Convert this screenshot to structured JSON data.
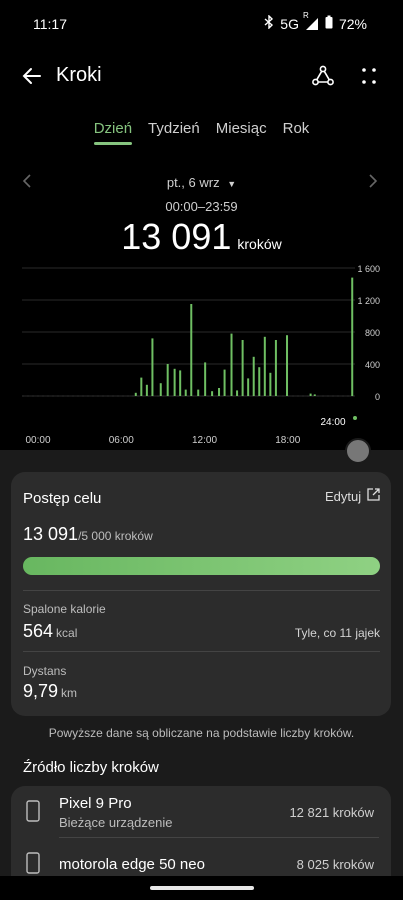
{
  "status": {
    "time": "11:17",
    "bluetooth_icon": "bluetooth-icon",
    "network": "5G",
    "roaming": "R",
    "battery": "72%"
  },
  "appbar": {
    "title": "Kroki",
    "back_icon": "arrow-left-icon",
    "share_icon": "share-icon",
    "more_icon": "more-grid-icon"
  },
  "tabs": [
    {
      "label": "Dzień",
      "active": true
    },
    {
      "label": "Tydzień",
      "active": false
    },
    {
      "label": "Miesiąc",
      "active": false
    },
    {
      "label": "Rok",
      "active": false
    }
  ],
  "date": {
    "selected": "pt., 6 wrz",
    "range": "00:00–23:59",
    "total": "13 091",
    "unit": "kroków"
  },
  "chart_data": {
    "type": "bar",
    "title": "",
    "xlabel": "",
    "ylabel": "",
    "x_tick_labels": [
      "00:00",
      "06:00",
      "12:00",
      "18:00",
      "24:00"
    ],
    "y_tick_labels": [
      "0",
      "400",
      "800",
      "1 200",
      "1 600"
    ],
    "ylim": [
      0,
      1600
    ],
    "x_range_hours": [
      0,
      24
    ],
    "bar_color": "#6fbf63",
    "values": [
      {
        "x": 8.2,
        "y": 40
      },
      {
        "x": 8.6,
        "y": 230
      },
      {
        "x": 9.0,
        "y": 140
      },
      {
        "x": 9.4,
        "y": 720
      },
      {
        "x": 10.0,
        "y": 160
      },
      {
        "x": 10.5,
        "y": 400
      },
      {
        "x": 11.0,
        "y": 340
      },
      {
        "x": 11.4,
        "y": 320
      },
      {
        "x": 11.8,
        "y": 80
      },
      {
        "x": 12.2,
        "y": 1150
      },
      {
        "x": 12.7,
        "y": 80
      },
      {
        "x": 13.2,
        "y": 420
      },
      {
        "x": 13.7,
        "y": 60
      },
      {
        "x": 14.2,
        "y": 100
      },
      {
        "x": 14.6,
        "y": 330
      },
      {
        "x": 15.1,
        "y": 780
      },
      {
        "x": 15.5,
        "y": 70
      },
      {
        "x": 15.9,
        "y": 700
      },
      {
        "x": 16.3,
        "y": 220
      },
      {
        "x": 16.7,
        "y": 490
      },
      {
        "x": 17.1,
        "y": 360
      },
      {
        "x": 17.5,
        "y": 740
      },
      {
        "x": 17.9,
        "y": 290
      },
      {
        "x": 18.3,
        "y": 700
      },
      {
        "x": 19.1,
        "y": 760
      },
      {
        "x": 20.8,
        "y": 30
      },
      {
        "x": 21.1,
        "y": 20
      },
      {
        "x": 23.8,
        "y": 1480
      }
    ]
  },
  "goal_card": {
    "title": "Postęp celu",
    "edit_label": "Edytuj",
    "edit_icon": "external-edit-icon",
    "value": "13 091",
    "goal": "/5 000 kroków",
    "progress": 1.0,
    "calories_label": "Spalone kalorie",
    "calories_value": "564",
    "calories_unit": "kcal",
    "calories_note": "Tyle, co 11 jajek",
    "distance_label": "Dystans",
    "distance_value": "9,79",
    "distance_unit": "km"
  },
  "note": "Powyższe dane są obliczane na podstawie liczby kroków.",
  "sources": {
    "title": "Źródło liczby kroków",
    "devices": [
      {
        "name": "Pixel 9 Pro",
        "sub": "Bieżące urządzenie",
        "steps": "12 821 kroków",
        "icon": "phone-icon"
      },
      {
        "name": "motorola edge 50 neo",
        "sub": "",
        "steps": "8 025 kroków",
        "icon": "phone-icon"
      }
    ]
  },
  "colors": {
    "accent": "#86c47f",
    "bar": "#6fbf63",
    "panel": "#2c2c2c",
    "sheet": "#1b1b1b"
  }
}
